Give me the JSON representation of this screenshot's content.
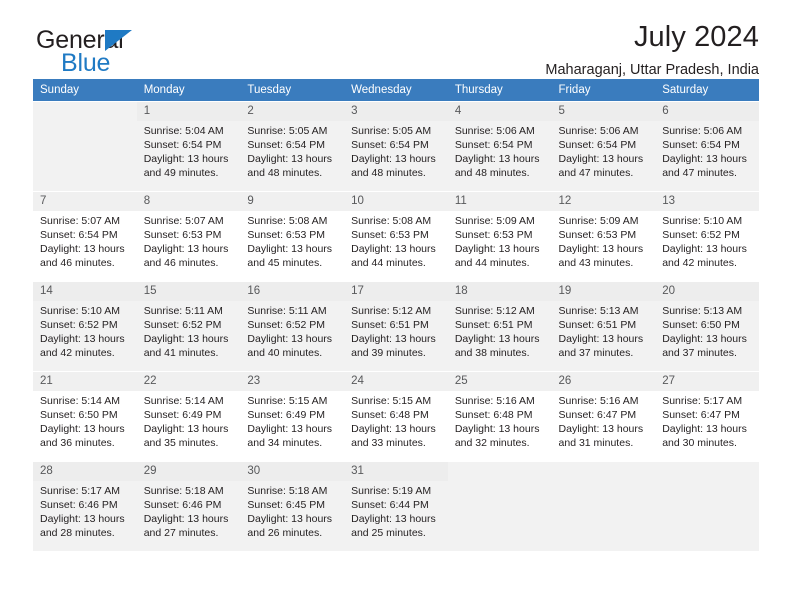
{
  "brand": {
    "name_part1": "General",
    "name_part2": "Blue",
    "triangle_icon": "brand-triangle-icon",
    "accent_color": "#1f7ac4"
  },
  "header": {
    "title": "July 2024",
    "subtitle": "Maharaganj, Uttar Pradesh, India"
  },
  "calendar": {
    "header_bg": "#3a7cbe",
    "weekdays": [
      "Sunday",
      "Monday",
      "Tuesday",
      "Wednesday",
      "Thursday",
      "Friday",
      "Saturday"
    ],
    "weeks": [
      {
        "shaded": true,
        "days": [
          {
            "num": "",
            "sunrise": "",
            "sunset": "",
            "daylight_line1": "",
            "daylight_line2": "",
            "empty": true
          },
          {
            "num": "1",
            "sunrise": "Sunrise: 5:04 AM",
            "sunset": "Sunset: 6:54 PM",
            "daylight_line1": "Daylight: 13 hours",
            "daylight_line2": "and 49 minutes."
          },
          {
            "num": "2",
            "sunrise": "Sunrise: 5:05 AM",
            "sunset": "Sunset: 6:54 PM",
            "daylight_line1": "Daylight: 13 hours",
            "daylight_line2": "and 48 minutes."
          },
          {
            "num": "3",
            "sunrise": "Sunrise: 5:05 AM",
            "sunset": "Sunset: 6:54 PM",
            "daylight_line1": "Daylight: 13 hours",
            "daylight_line2": "and 48 minutes."
          },
          {
            "num": "4",
            "sunrise": "Sunrise: 5:06 AM",
            "sunset": "Sunset: 6:54 PM",
            "daylight_line1": "Daylight: 13 hours",
            "daylight_line2": "and 48 minutes."
          },
          {
            "num": "5",
            "sunrise": "Sunrise: 5:06 AM",
            "sunset": "Sunset: 6:54 PM",
            "daylight_line1": "Daylight: 13 hours",
            "daylight_line2": "and 47 minutes."
          },
          {
            "num": "6",
            "sunrise": "Sunrise: 5:06 AM",
            "sunset": "Sunset: 6:54 PM",
            "daylight_line1": "Daylight: 13 hours",
            "daylight_line2": "and 47 minutes."
          }
        ]
      },
      {
        "shaded": false,
        "days": [
          {
            "num": "7",
            "sunrise": "Sunrise: 5:07 AM",
            "sunset": "Sunset: 6:54 PM",
            "daylight_line1": "Daylight: 13 hours",
            "daylight_line2": "and 46 minutes."
          },
          {
            "num": "8",
            "sunrise": "Sunrise: 5:07 AM",
            "sunset": "Sunset: 6:53 PM",
            "daylight_line1": "Daylight: 13 hours",
            "daylight_line2": "and 46 minutes."
          },
          {
            "num": "9",
            "sunrise": "Sunrise: 5:08 AM",
            "sunset": "Sunset: 6:53 PM",
            "daylight_line1": "Daylight: 13 hours",
            "daylight_line2": "and 45 minutes."
          },
          {
            "num": "10",
            "sunrise": "Sunrise: 5:08 AM",
            "sunset": "Sunset: 6:53 PM",
            "daylight_line1": "Daylight: 13 hours",
            "daylight_line2": "and 44 minutes."
          },
          {
            "num": "11",
            "sunrise": "Sunrise: 5:09 AM",
            "sunset": "Sunset: 6:53 PM",
            "daylight_line1": "Daylight: 13 hours",
            "daylight_line2": "and 44 minutes."
          },
          {
            "num": "12",
            "sunrise": "Sunrise: 5:09 AM",
            "sunset": "Sunset: 6:53 PM",
            "daylight_line1": "Daylight: 13 hours",
            "daylight_line2": "and 43 minutes."
          },
          {
            "num": "13",
            "sunrise": "Sunrise: 5:10 AM",
            "sunset": "Sunset: 6:52 PM",
            "daylight_line1": "Daylight: 13 hours",
            "daylight_line2": "and 42 minutes."
          }
        ]
      },
      {
        "shaded": true,
        "days": [
          {
            "num": "14",
            "sunrise": "Sunrise: 5:10 AM",
            "sunset": "Sunset: 6:52 PM",
            "daylight_line1": "Daylight: 13 hours",
            "daylight_line2": "and 42 minutes."
          },
          {
            "num": "15",
            "sunrise": "Sunrise: 5:11 AM",
            "sunset": "Sunset: 6:52 PM",
            "daylight_line1": "Daylight: 13 hours",
            "daylight_line2": "and 41 minutes."
          },
          {
            "num": "16",
            "sunrise": "Sunrise: 5:11 AM",
            "sunset": "Sunset: 6:52 PM",
            "daylight_line1": "Daylight: 13 hours",
            "daylight_line2": "and 40 minutes."
          },
          {
            "num": "17",
            "sunrise": "Sunrise: 5:12 AM",
            "sunset": "Sunset: 6:51 PM",
            "daylight_line1": "Daylight: 13 hours",
            "daylight_line2": "and 39 minutes."
          },
          {
            "num": "18",
            "sunrise": "Sunrise: 5:12 AM",
            "sunset": "Sunset: 6:51 PM",
            "daylight_line1": "Daylight: 13 hours",
            "daylight_line2": "and 38 minutes."
          },
          {
            "num": "19",
            "sunrise": "Sunrise: 5:13 AM",
            "sunset": "Sunset: 6:51 PM",
            "daylight_line1": "Daylight: 13 hours",
            "daylight_line2": "and 37 minutes."
          },
          {
            "num": "20",
            "sunrise": "Sunrise: 5:13 AM",
            "sunset": "Sunset: 6:50 PM",
            "daylight_line1": "Daylight: 13 hours",
            "daylight_line2": "and 37 minutes."
          }
        ]
      },
      {
        "shaded": false,
        "days": [
          {
            "num": "21",
            "sunrise": "Sunrise: 5:14 AM",
            "sunset": "Sunset: 6:50 PM",
            "daylight_line1": "Daylight: 13 hours",
            "daylight_line2": "and 36 minutes."
          },
          {
            "num": "22",
            "sunrise": "Sunrise: 5:14 AM",
            "sunset": "Sunset: 6:49 PM",
            "daylight_line1": "Daylight: 13 hours",
            "daylight_line2": "and 35 minutes."
          },
          {
            "num": "23",
            "sunrise": "Sunrise: 5:15 AM",
            "sunset": "Sunset: 6:49 PM",
            "daylight_line1": "Daylight: 13 hours",
            "daylight_line2": "and 34 minutes."
          },
          {
            "num": "24",
            "sunrise": "Sunrise: 5:15 AM",
            "sunset": "Sunset: 6:48 PM",
            "daylight_line1": "Daylight: 13 hours",
            "daylight_line2": "and 33 minutes."
          },
          {
            "num": "25",
            "sunrise": "Sunrise: 5:16 AM",
            "sunset": "Sunset: 6:48 PM",
            "daylight_line1": "Daylight: 13 hours",
            "daylight_line2": "and 32 minutes."
          },
          {
            "num": "26",
            "sunrise": "Sunrise: 5:16 AM",
            "sunset": "Sunset: 6:47 PM",
            "daylight_line1": "Daylight: 13 hours",
            "daylight_line2": "and 31 minutes."
          },
          {
            "num": "27",
            "sunrise": "Sunrise: 5:17 AM",
            "sunset": "Sunset: 6:47 PM",
            "daylight_line1": "Daylight: 13 hours",
            "daylight_line2": "and 30 minutes."
          }
        ]
      },
      {
        "shaded": true,
        "days": [
          {
            "num": "28",
            "sunrise": "Sunrise: 5:17 AM",
            "sunset": "Sunset: 6:46 PM",
            "daylight_line1": "Daylight: 13 hours",
            "daylight_line2": "and 28 minutes."
          },
          {
            "num": "29",
            "sunrise": "Sunrise: 5:18 AM",
            "sunset": "Sunset: 6:46 PM",
            "daylight_line1": "Daylight: 13 hours",
            "daylight_line2": "and 27 minutes."
          },
          {
            "num": "30",
            "sunrise": "Sunrise: 5:18 AM",
            "sunset": "Sunset: 6:45 PM",
            "daylight_line1": "Daylight: 13 hours",
            "daylight_line2": "and 26 minutes."
          },
          {
            "num": "31",
            "sunrise": "Sunrise: 5:19 AM",
            "sunset": "Sunset: 6:44 PM",
            "daylight_line1": "Daylight: 13 hours",
            "daylight_line2": "and 25 minutes."
          },
          {
            "num": "",
            "sunrise": "",
            "sunset": "",
            "daylight_line1": "",
            "daylight_line2": "",
            "empty": true
          },
          {
            "num": "",
            "sunrise": "",
            "sunset": "",
            "daylight_line1": "",
            "daylight_line2": "",
            "empty": true
          },
          {
            "num": "",
            "sunrise": "",
            "sunset": "",
            "daylight_line1": "",
            "daylight_line2": "",
            "empty": true
          }
        ]
      }
    ]
  }
}
